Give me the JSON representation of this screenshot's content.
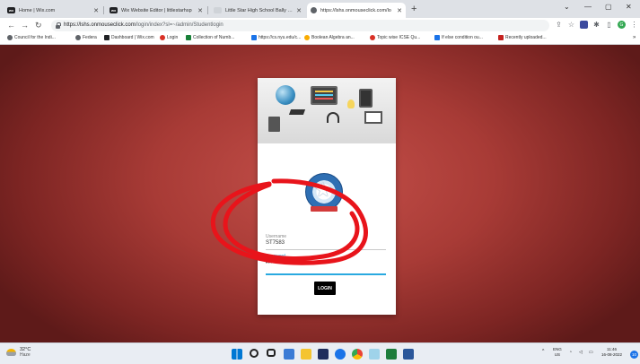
{
  "tabs": [
    {
      "label": "Home | Wix.com",
      "favicon": "wix-icon",
      "active": false
    },
    {
      "label": "Wix Website Editor | littlestarhsp",
      "favicon": "wix-icon",
      "active": false
    },
    {
      "label": "Little Star High School Bally | ICSE",
      "favicon": "page-icon",
      "active": false
    },
    {
      "label": "https://lshs.onmouseclick.com/lo",
      "favicon": "globe-icon",
      "active": true
    }
  ],
  "address_bar": {
    "url_domain": "https://lshs.onmouseclick.com",
    "url_path": "/login/index?sl=~/admin/Studentlogin"
  },
  "bookmarks": [
    {
      "label": "Council for the Indi...",
      "color": "#5f6368"
    },
    {
      "label": "Federa",
      "color": "#5f6368"
    },
    {
      "label": "Dashboard | Wix.com",
      "color": "#202124"
    },
    {
      "label": "Login",
      "color": "#d93025"
    },
    {
      "label": "Collection of Numb...",
      "color": "#188038"
    },
    {
      "label": "https://cs.nyu.edu/c...",
      "color": "#1a73e8"
    },
    {
      "label": "Boolean Algebra an...",
      "color": "#f9ab00"
    },
    {
      "label": "Topic wise ICSE Qu...",
      "color": "#d93025"
    },
    {
      "label": "If else condition ou...",
      "color": "#1a73e8"
    },
    {
      "label": "Recently uploaded...",
      "color": "#c5221f"
    }
  ],
  "login_form": {
    "username_label": "Username",
    "username_value": "ST7583",
    "password_label": "Password",
    "password_value": "••••••",
    "login_button": "LOGIN",
    "accent_color": "#29a9e0"
  },
  "taskbar": {
    "weather_temp": "32°C",
    "weather_desc": "Haze",
    "language": "ENG",
    "region": "US",
    "time": "11:46",
    "date": "16-08-2022",
    "notification_count": "10"
  },
  "colors": {
    "background_red": "#a83b36",
    "annotation_red": "#e8141b"
  }
}
